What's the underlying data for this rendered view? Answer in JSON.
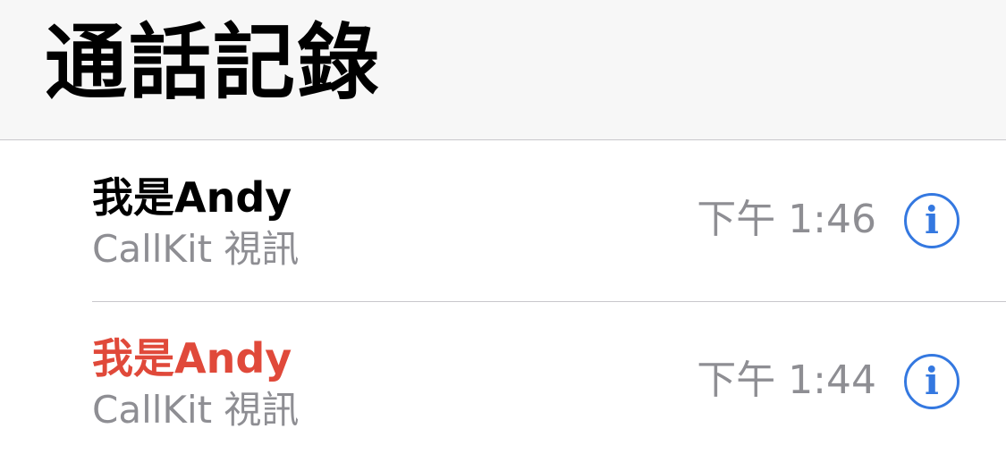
{
  "header": {
    "title": "通話記錄"
  },
  "calls": [
    {
      "name": "我是Andy",
      "type": "CallKit 視訊",
      "time": "下午 1:46",
      "missed": false,
      "info_icon": "i"
    },
    {
      "name": "我是Andy",
      "type": "CallKit 視訊",
      "time": "下午 1:44",
      "missed": true,
      "info_icon": "i"
    }
  ],
  "colors": {
    "header_background": "#f7f7f7",
    "missed_call": "#e0493a",
    "secondary_text": "#8e8e93",
    "accent": "#3478e0",
    "separator": "#c8c7cc"
  }
}
